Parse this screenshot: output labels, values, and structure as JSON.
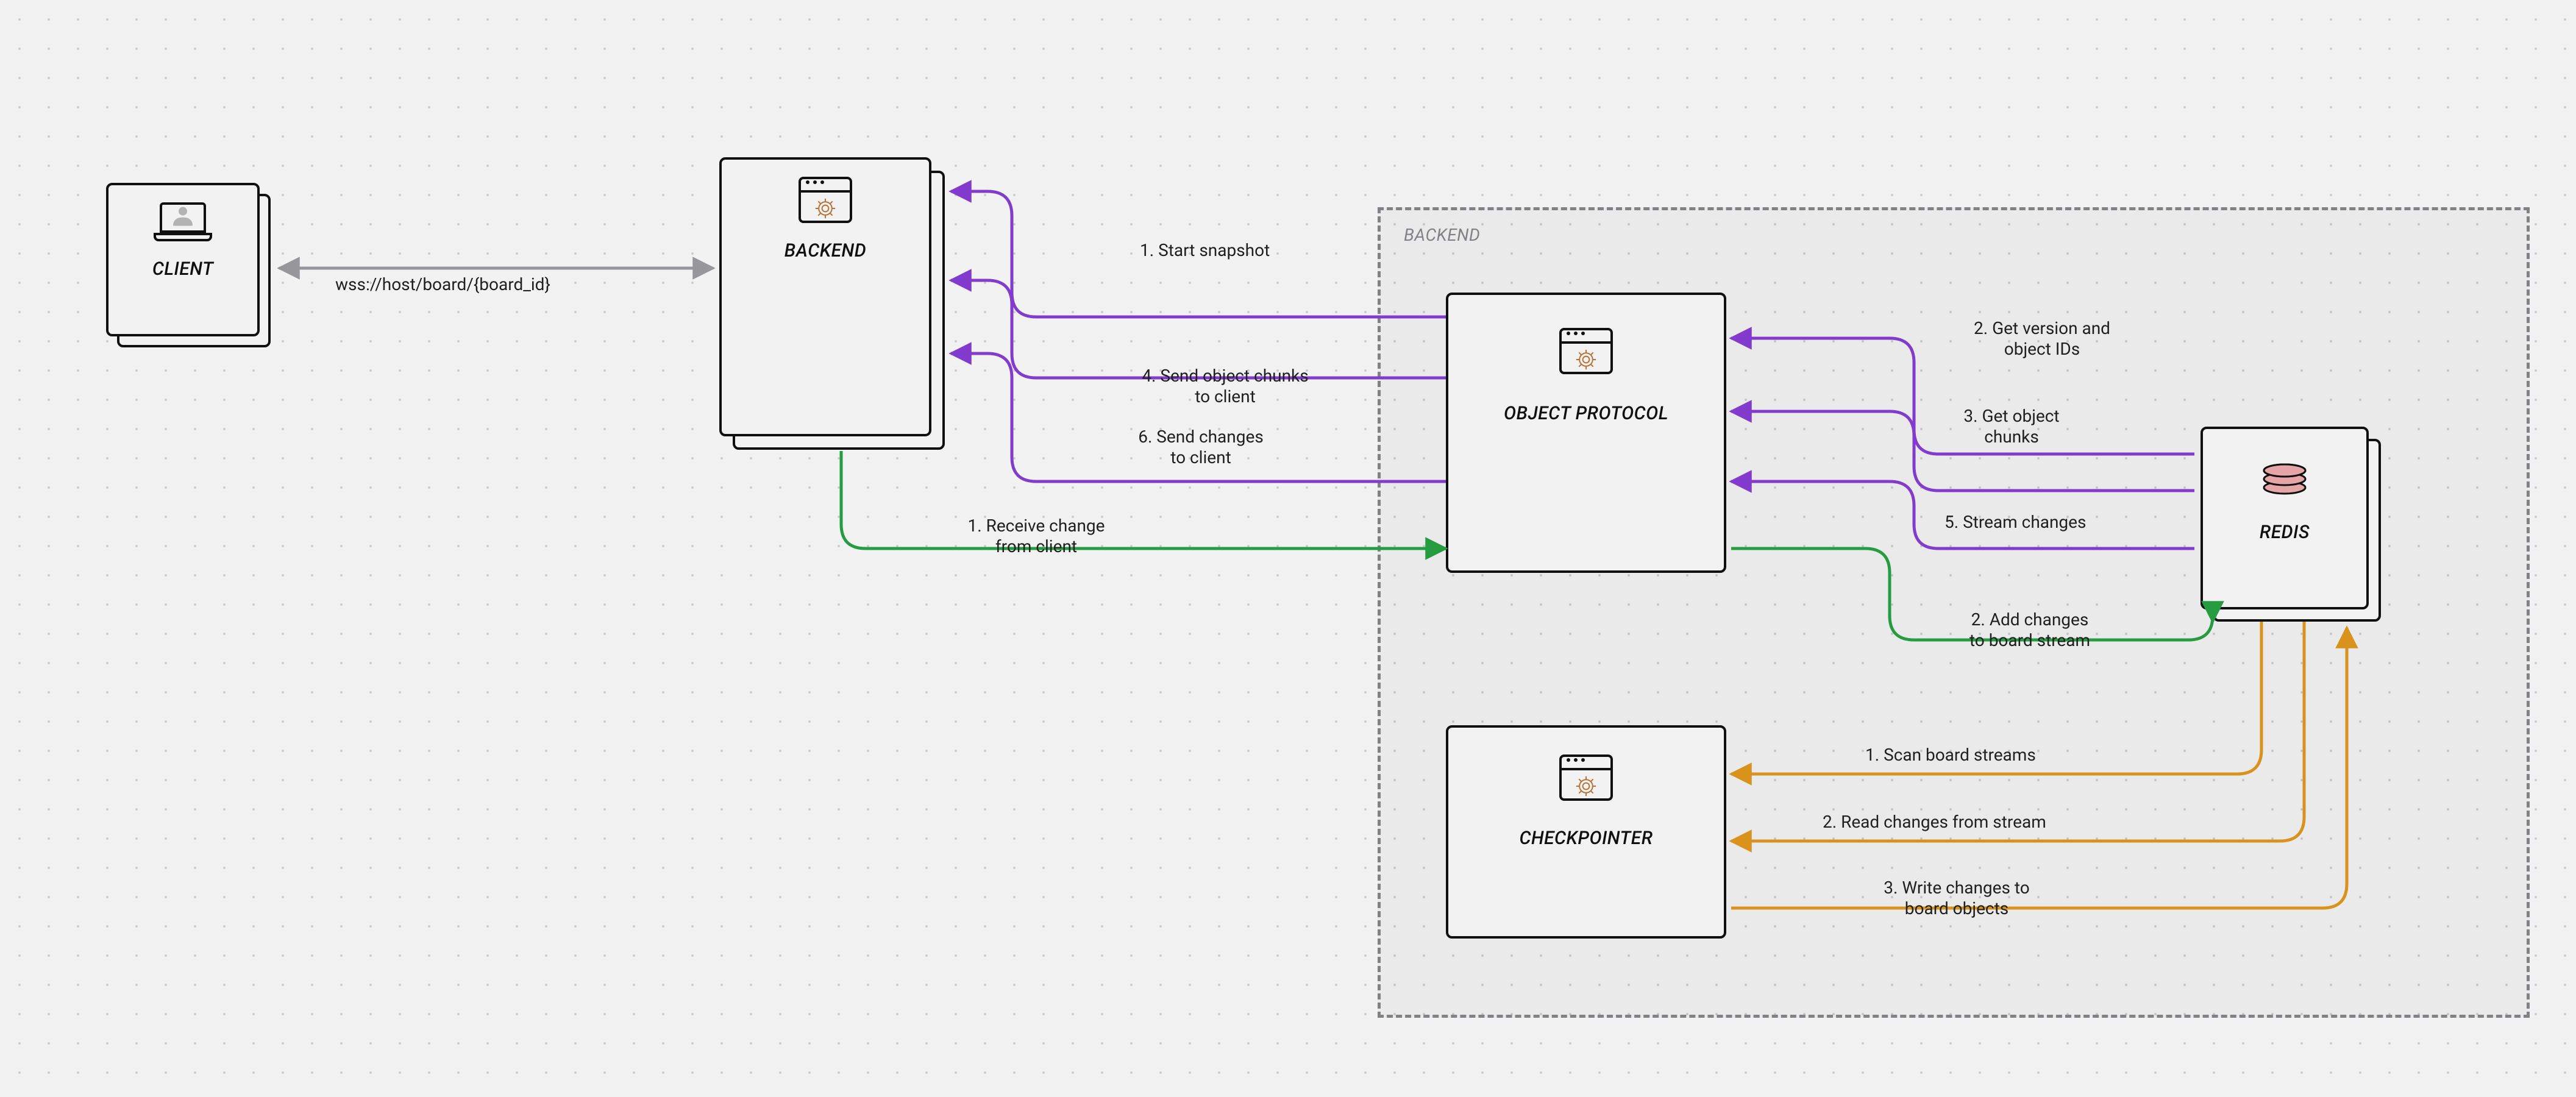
{
  "nodes": {
    "client": {
      "label": "CLIENT"
    },
    "backend": {
      "label": "BACKEND"
    },
    "object_protocol": {
      "label": "OBJECT PROTOCOL"
    },
    "checkpointer": {
      "label": "CHECKPOINTER"
    },
    "redis": {
      "label": "REDIS"
    }
  },
  "backend_group": {
    "label": "BACKEND"
  },
  "edges": {
    "client_backend": {
      "label": "wss://host/board/{board_id}"
    },
    "snapshot_start": {
      "label": "1. Start snapshot"
    },
    "snapshot_chunks": {
      "label": "4. Send object chunks\nto client"
    },
    "snapshot_changes": {
      "label": "6. Send changes\nto client"
    },
    "change_receive": {
      "label": "1. Receive change\nfrom client"
    },
    "redis_version": {
      "label": "2. Get version and\nobject IDs"
    },
    "redis_chunks": {
      "label": "3. Get object\nchunks"
    },
    "redis_stream": {
      "label": "5. Stream changes"
    },
    "redis_add": {
      "label": "2. Add changes\nto board stream"
    },
    "cp_scan": {
      "label": "1. Scan board streams"
    },
    "cp_read": {
      "label": "2. Read changes from stream"
    },
    "cp_write": {
      "label": "3. Write changes to\nboard objects"
    }
  },
  "colors": {
    "purple": "#8b3fd9",
    "green": "#27a544",
    "orange": "#e59a1e",
    "gray": "#a0a0a4",
    "rust": "#c17a3a",
    "redis": "#f3aeb0"
  }
}
